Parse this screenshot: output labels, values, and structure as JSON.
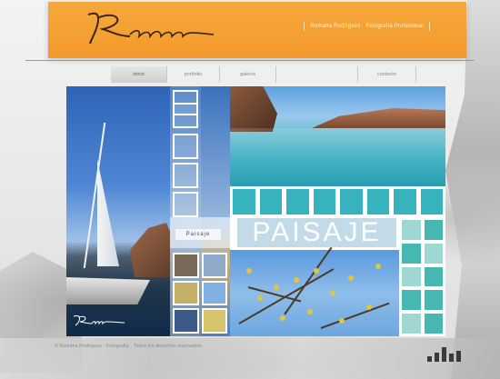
{
  "brand": {
    "logo_text": "Romana",
    "accent_color": "#f29a2a"
  },
  "header": {
    "links": [
      "Romana Rodríguez",
      "Fotografía Profesional"
    ]
  },
  "nav": {
    "items": [
      {
        "label": "inicio",
        "active": true
      },
      {
        "label": "portfolio",
        "active": false
      },
      {
        "label": "galería",
        "active": false
      },
      {
        "label": "",
        "active": false
      },
      {
        "label": "contacto",
        "active": false
      }
    ]
  },
  "collage": {
    "category_label": "Paisaje",
    "title": "PAISAJE",
    "watermark": "Romana",
    "colors": {
      "teal": "#37b3bd",
      "sky": "#4f87d4"
    }
  },
  "footer": {
    "text": "© Romana Rodríguez · Fotografía · Todos los derechos reservados",
    "equalizer_icon": "sound-bars-icon"
  }
}
